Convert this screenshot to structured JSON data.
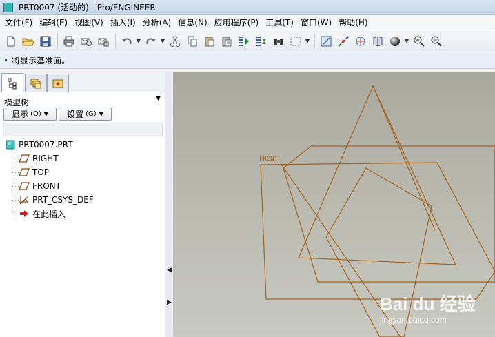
{
  "window": {
    "title": "PRT0007 (活动的) - Pro/ENGINEER"
  },
  "menubar": {
    "items": [
      "文件(F)",
      "编辑(E)",
      "视图(V)",
      "插入(I)",
      "分析(A)",
      "信息(N)",
      "应用程序(P)",
      "工具(T)",
      "窗口(W)",
      "帮助(H)"
    ]
  },
  "toolbar": {
    "icons": [
      "new-file",
      "open-folder",
      "save",
      "print",
      "email",
      "email-attach",
      "undo",
      "redo",
      "cut",
      "copy",
      "paste",
      "paste-special",
      "regenerate",
      "regenerate-manager",
      "find",
      "select-box",
      "repaint",
      "spin-center",
      "orient-mode",
      "saved-views",
      "shading",
      "zoom-in",
      "zoom-out"
    ]
  },
  "message": {
    "text": "将显示基准面。"
  },
  "panel": {
    "heading": "模型树",
    "show_button": "显示",
    "show_shortcut": "(O)",
    "settings_button": "设置",
    "settings_shortcut": "(G)",
    "tree": {
      "root": "PRT0007.PRT",
      "items": [
        {
          "label": "RIGHT",
          "icon": "datum-plane"
        },
        {
          "label": "TOP",
          "icon": "datum-plane"
        },
        {
          "label": "FRONT",
          "icon": "datum-plane"
        },
        {
          "label": "PRT_CSYS_DEF",
          "icon": "coordinate-system"
        },
        {
          "label": "在此插入",
          "icon": "insert-arrow"
        }
      ]
    }
  },
  "viewport": {
    "datum_label": "FRONT",
    "datum_color": "#b06818",
    "watermark_main": "Bai du 经验",
    "watermark_sub": "jingyan.baidu.com"
  }
}
